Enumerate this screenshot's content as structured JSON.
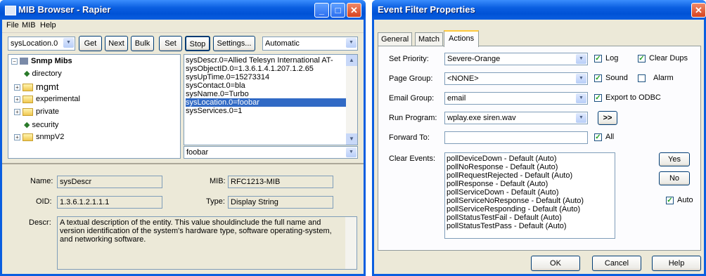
{
  "mib_browser": {
    "title": "MIB Browser - Rapier",
    "menu": [
      "File",
      "MIB",
      "Help"
    ],
    "location_combo": "sysLocation.0",
    "buttons": {
      "get": "Get",
      "next": "Next",
      "bulk": "Bulk",
      "set": "Set",
      "stop": "Stop",
      "settings": "Settings..."
    },
    "mode_combo": "Automatic",
    "tree": {
      "root": "Snmp Mibs",
      "items": [
        "directory",
        "mgmt",
        "experimental",
        "private",
        "security",
        "snmpV2"
      ]
    },
    "results": [
      "sysDescr.0=Allied Telesyn International AT-",
      "sysObjectID.0=1.3.6.1.4.1.207.1.2.65",
      "sysUpTime.0=15273314",
      "sysContact.0=bla",
      "sysName.0=Turbo",
      "sysLocation.0=foobar",
      "sysServices.0=1"
    ],
    "selected_result_index": 5,
    "value_combo": "foobar",
    "details": {
      "name_label": "Name:",
      "name": "sysDescr",
      "mib_label": "MIB:",
      "mib": "RFC1213-MIB",
      "oid_label": "OID:",
      "oid": "1.3.6.1.2.1.1.1",
      "type_label": "Type:",
      "type": "Display String",
      "descr_label": "Descr:",
      "descr": "A textual description of the entity.  This value shouldinclude the full name and version identification of the system's hardware type, software operating-system, and networking software."
    }
  },
  "event_filter": {
    "title": "Event Filter Properties",
    "tabs": [
      "General",
      "Match",
      "Actions"
    ],
    "active_tab": "Actions",
    "set_priority_label": "Set Priority:",
    "set_priority": "Severe-Orange",
    "page_group_label": "Page Group:",
    "page_group": "<NONE>",
    "email_group_label": "Email Group:",
    "email_group": "email",
    "run_program_label": "Run Program:",
    "run_program": "wplay.exe siren.wav",
    "run_program_button": ">>",
    "forward_to_label": "Forward To:",
    "forward_to": "",
    "checkboxes": {
      "log": {
        "label": "Log",
        "checked": true
      },
      "clear_dups": {
        "label": "Clear Dups",
        "checked": true
      },
      "sound": {
        "label": "Sound",
        "checked": true
      },
      "alarm": {
        "label": "Alarm",
        "checked": false
      },
      "export_odbc": {
        "label": "Export to ODBC",
        "checked": true
      },
      "all": {
        "label": "All",
        "checked": true
      },
      "auto": {
        "label": "Auto",
        "checked": true
      }
    },
    "clear_events_label": "Clear Events:",
    "clear_events": [
      "pollDeviceDown - Default (Auto)",
      "pollNoResponse - Default (Auto)",
      "pollRequestRejected - Default (Auto)",
      "pollResponse - Default (Auto)",
      "pollServiceDown - Default (Auto)",
      "pollServiceNoResponse - Default (Auto)",
      "pollServiceResponding - Default (Auto)",
      "pollStatusTestFail - Default (Auto)",
      "pollStatusTestPass - Default (Auto)"
    ],
    "yes_button": "Yes",
    "no_button": "No",
    "ok_button": "OK",
    "cancel_button": "Cancel",
    "help_button": "Help"
  },
  "colors": {
    "titlebar": "#0a5ee0",
    "dialog_bg": "#ece9d8",
    "selection": "#316ac5"
  }
}
